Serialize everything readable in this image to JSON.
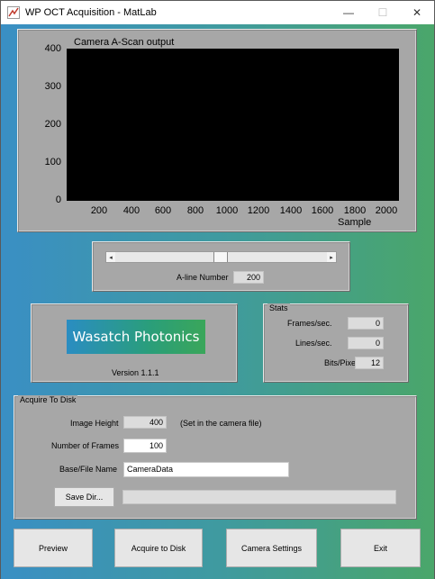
{
  "window": {
    "title": "WP OCT Acquisition - MatLab",
    "minimize": "—",
    "maximize": "☐",
    "close": "✕"
  },
  "plot": {
    "title": "Camera A-Scan output",
    "yticks": [
      "400",
      "300",
      "200",
      "100",
      "0"
    ],
    "xticks": [
      "200",
      "400",
      "600",
      "800",
      "1000",
      "1200",
      "1400",
      "1600",
      "1800",
      "2000"
    ],
    "xlabel": "Sample"
  },
  "chart_data": {
    "type": "line",
    "title": "Camera A-Scan output",
    "xlabel": "Sample",
    "ylabel": "",
    "xlim": [
      0,
      2100
    ],
    "ylim": [
      0,
      400
    ],
    "series": []
  },
  "slider_panel": {
    "label": "A-line Number",
    "value": "200",
    "left_arrow": "◂",
    "right_arrow": "▸",
    "position_fraction": 0.49
  },
  "logo": {
    "text": "Wasatch Photonics",
    "version": "Version 1.1.1"
  },
  "stats": {
    "title": "Stats",
    "frames_label": "Frames/sec.",
    "frames_value": "0",
    "lines_label": "Lines/sec.",
    "lines_value": "0",
    "bits_label": "Bits/Pixel",
    "bits_value": "12"
  },
  "acquire": {
    "title": "Acquire To Disk",
    "image_height_label": "Image Height",
    "image_height_value": "400",
    "image_height_note": "(Set in the camera file)",
    "frames_label": "Number of Frames",
    "frames_value": "100",
    "filename_label": "Base/File Name",
    "filename_value": "CameraData",
    "save_dir_label": "Save Dir...",
    "save_dir_path": ""
  },
  "buttons": {
    "preview": "Preview",
    "acquire": "Acquire to Disk",
    "camera_settings": "Camera Settings",
    "exit": "Exit"
  }
}
